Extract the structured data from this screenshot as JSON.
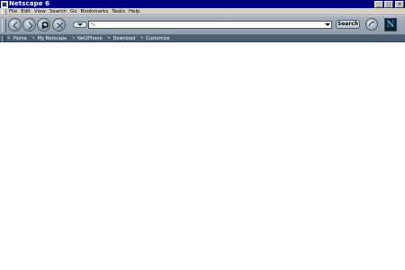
{
  "window": {
    "title": "Netscape 6",
    "minimize_glyph": "_",
    "maximize_glyph": "□",
    "close_glyph": "×"
  },
  "menu": [
    "File",
    "Edit",
    "View",
    "Search",
    "Go",
    "Bookmarks",
    "Tasks",
    "Help"
  ],
  "navbar": {
    "url_value": "",
    "url_icon": "%",
    "search_label": "Search",
    "back_icon": "back-arrow-icon",
    "forward_icon": "forward-arrow-icon",
    "reload_icon": "reload-icon",
    "stop_icon": "stop-icon"
  },
  "personal_toolbar": [
    {
      "label": "Home",
      "icon": "home-icon"
    },
    {
      "label": "My Netscape",
      "icon": "bookmark-icon"
    },
    {
      "label": "Net2Phone",
      "icon": "bookmark-icon"
    },
    {
      "label": "Download",
      "icon": "bookmark-icon"
    },
    {
      "label": "Customize",
      "icon": "bookmark-icon"
    }
  ],
  "colors": {
    "titlebar": "#000080",
    "menubar": "#d4d0c8",
    "navbar": "#9aa7b4",
    "personal_toolbar": "#4d5e78",
    "logo_accent": "#4fa6c8"
  }
}
